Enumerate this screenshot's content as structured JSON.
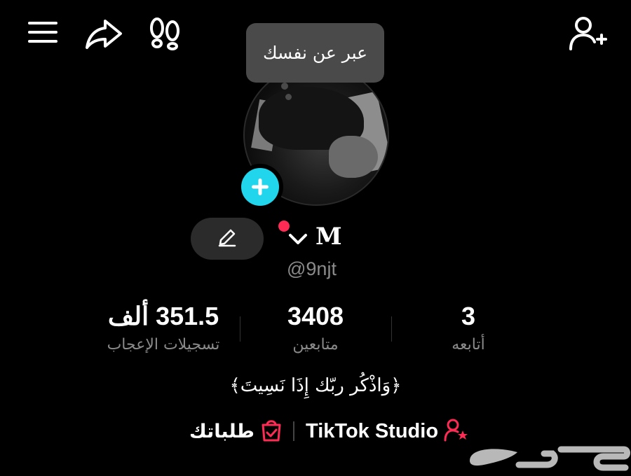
{
  "header": {
    "icons": [
      "menu-icon",
      "share-icon",
      "footprints-icon",
      "add-friend-icon"
    ]
  },
  "profile": {
    "tooltip": "عبر عن نفسك",
    "display_name": "M",
    "username": "@9njt",
    "edit_icon": "pencil-icon",
    "add_photo_icon": "plus-icon"
  },
  "stats": {
    "likes": {
      "value": "351.5 ألف",
      "label": "تسجيلات الإعجاب"
    },
    "followers": {
      "value": "3408",
      "label": "متابعين"
    },
    "following": {
      "value": "3",
      "label": "أتابعه"
    }
  },
  "bio": "﴿وَاذْكُر ربّك إِذَا نَسِيتَ﴾",
  "links": {
    "studio": "TikTok Studio",
    "orders": "طلباتك"
  },
  "watermark": "حراج",
  "colors": {
    "background": "#000000",
    "accent_cyan": "#20d5ec",
    "accent_red": "#fe2c55",
    "muted_text": "#8a8a8a"
  }
}
